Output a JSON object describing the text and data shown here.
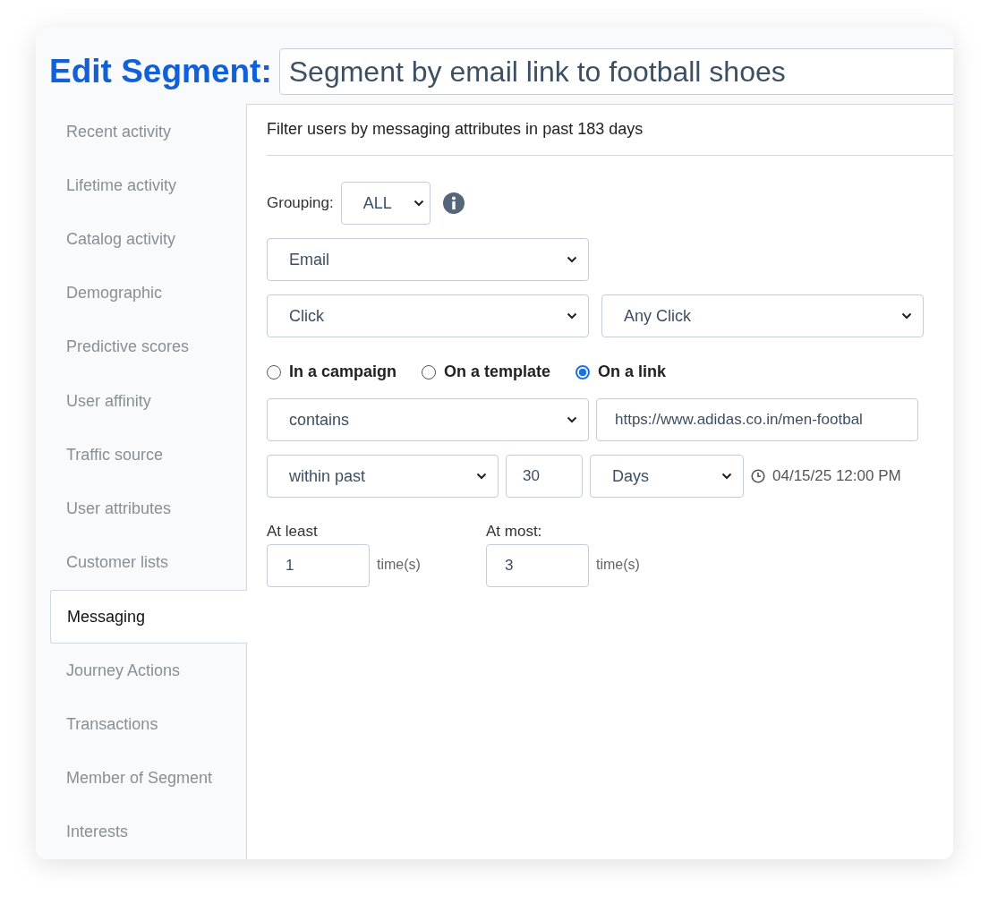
{
  "header": {
    "title": "Edit Segment:",
    "segment_name": "Segment by email link to football shoes"
  },
  "sidebar": {
    "items": [
      {
        "label": "Recent activity",
        "selected": false
      },
      {
        "label": "Lifetime activity",
        "selected": false
      },
      {
        "label": "Catalog activity",
        "selected": false
      },
      {
        "label": "Demographic",
        "selected": false
      },
      {
        "label": "Predictive scores",
        "selected": false
      },
      {
        "label": "User affinity",
        "selected": false
      },
      {
        "label": "Traffic source",
        "selected": false
      },
      {
        "label": "User attributes",
        "selected": false
      },
      {
        "label": "Customer lists",
        "selected": false
      },
      {
        "label": "Messaging",
        "selected": true
      },
      {
        "label": "Journey Actions",
        "selected": false
      },
      {
        "label": "Transactions",
        "selected": false
      },
      {
        "label": "Member of Segment",
        "selected": false
      },
      {
        "label": "Interests",
        "selected": false
      }
    ]
  },
  "panel": {
    "heading": "Filter users by messaging attributes in past 183 days",
    "grouping": {
      "label": "Grouping:",
      "value": "ALL"
    },
    "channel": "Email",
    "event": "Click",
    "event_type": "Any Click",
    "targets": [
      {
        "label": "In a campaign",
        "selected": false
      },
      {
        "label": "On a template",
        "selected": false
      },
      {
        "label": "On a link",
        "selected": true
      }
    ],
    "link_operator": "contains",
    "link_value": "https://www.adidas.co.in/men-footbal",
    "time_operator": "within past",
    "time_amount": "30",
    "time_unit": "Days",
    "timestamp": "04/15/25 12:00 PM",
    "counts": [
      {
        "label": "At least",
        "value": "1",
        "unit": "time(s)"
      },
      {
        "label": "At most:",
        "value": "3",
        "unit": "time(s)"
      }
    ]
  }
}
